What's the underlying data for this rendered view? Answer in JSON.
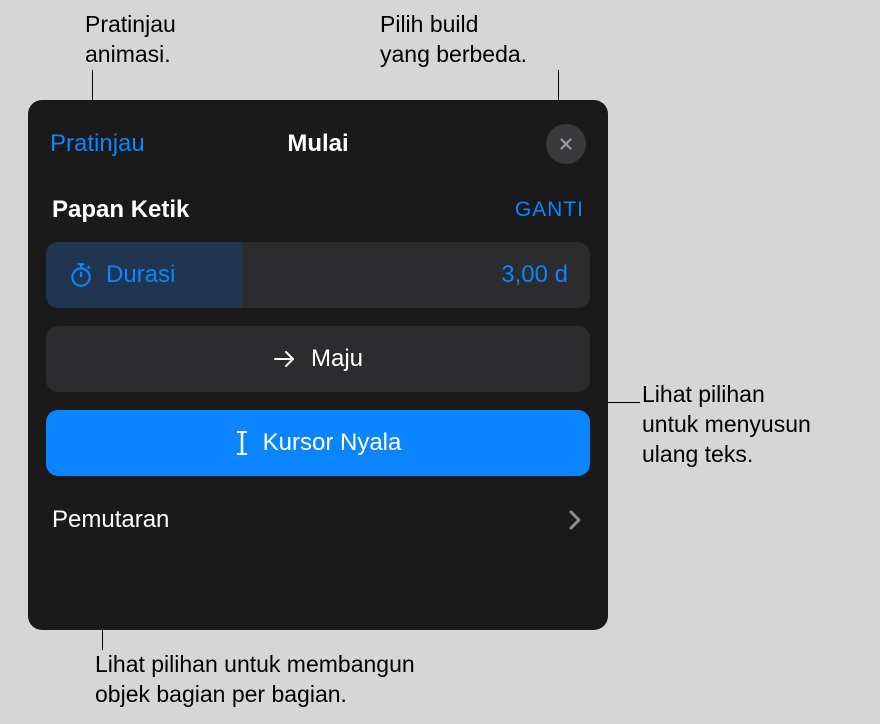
{
  "callouts": {
    "topLeft": "Pratinjau\nanimasi.",
    "topRight": "Pilih build\nyang berbeda.",
    "right": "Lihat pilihan\nuntuk menyusun\nulang teks.",
    "bottom": "Lihat pilihan untuk membangun\nobjek bagian per bagian."
  },
  "panel": {
    "preview": "Pratinjau",
    "title": "Mulai",
    "effectName": "Papan Ketik",
    "change": "GANTI",
    "durationLabel": "Durasi",
    "durationValue": "3,00 d",
    "direction": "Maju",
    "cursor": "Kursor Nyala",
    "playback": "Pemutaran"
  }
}
